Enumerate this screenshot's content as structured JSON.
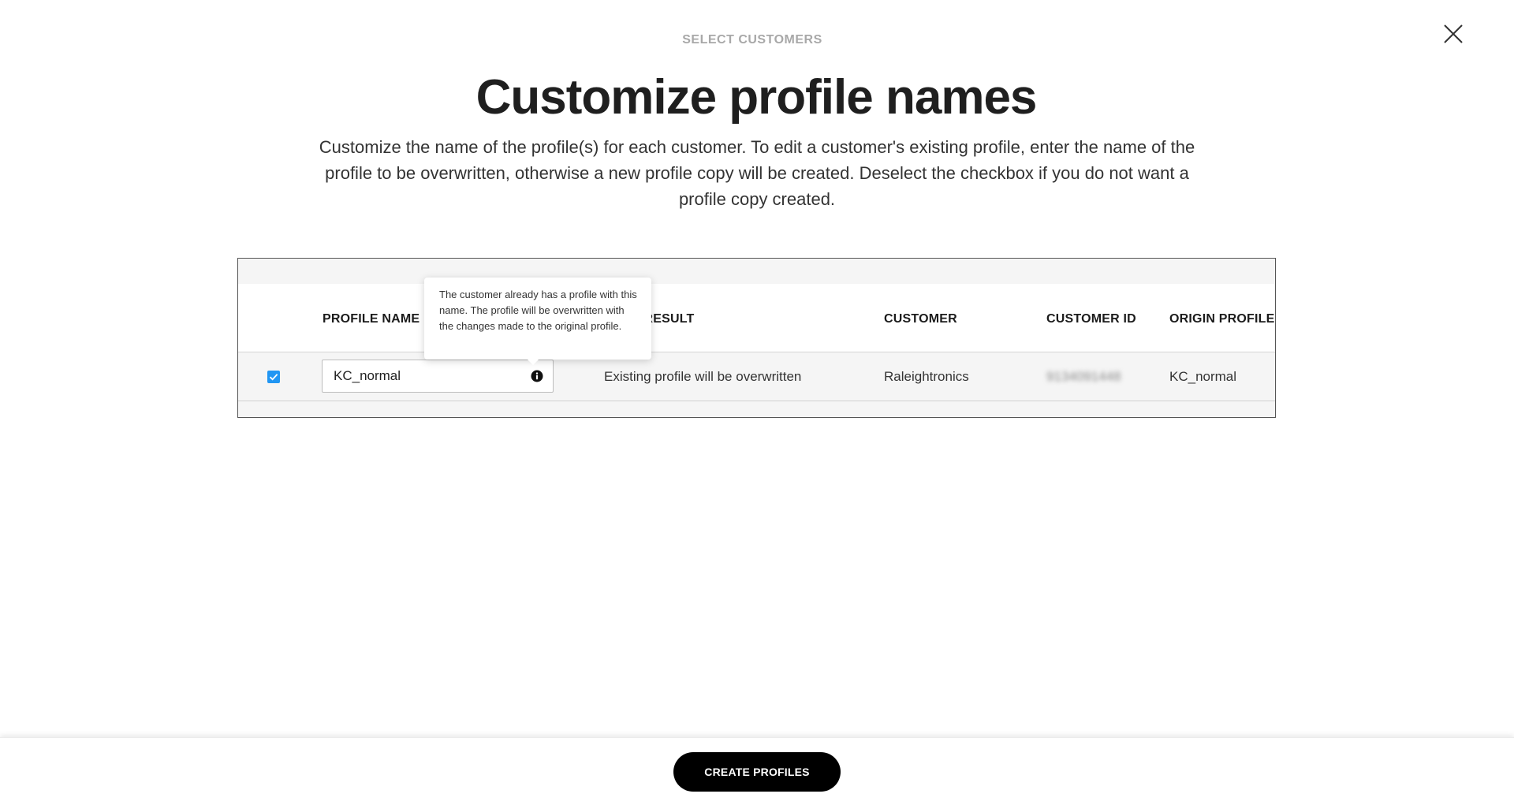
{
  "header": {
    "step_label": "SELECT CUSTOMERS",
    "title": "Customize profile names",
    "description": "Customize the name of the profile(s) for each customer. To edit a customer's existing profile, enter the name of the profile to be overwritten, otherwise a new profile copy will be created. Deselect the checkbox if you do not want a profile copy created.",
    "close_icon": "close-icon"
  },
  "table": {
    "columns": {
      "profile_name": "PROFILE NAME",
      "expected_result": "EXPECTED RESULT",
      "customer": "CUSTOMER",
      "customer_id": "CUSTOMER ID",
      "origin_profile": "ORIGIN PROFILE"
    },
    "rows": [
      {
        "checked": true,
        "profile_name": "KC_normal",
        "expected_result": "Existing profile will be overwritten",
        "customer": "Raleightronics",
        "customer_id": "9134091448",
        "origin_profile": "KC_normal"
      }
    ]
  },
  "tooltip": {
    "text": "The customer already has a profile with this name. The profile will be overwritten with the changes made to the original profile."
  },
  "footer": {
    "create_button": "CREATE PROFILES"
  },
  "colors": {
    "checkbox": "#2196f3",
    "button_bg": "#000000",
    "step_label": "#a8a8a8"
  }
}
